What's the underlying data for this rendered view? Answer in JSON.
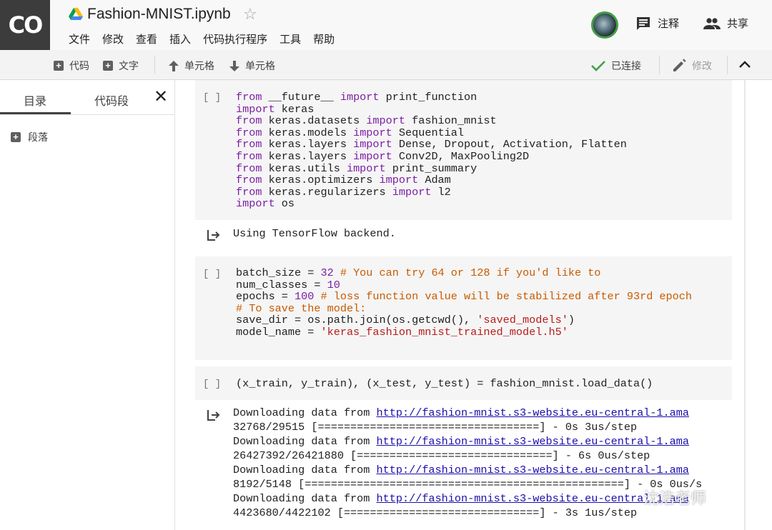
{
  "header": {
    "logo": "CO",
    "notebook_title": "Fashion-MNIST.ipynb",
    "menu": [
      "文件",
      "修改",
      "查看",
      "插入",
      "代码执行程序",
      "工具",
      "帮助"
    ],
    "comment_label": "注释",
    "share_label": "共享"
  },
  "toolbar": {
    "add_code": "代码",
    "add_text": "文字",
    "cell_up": "单元格",
    "cell_down": "单元格",
    "connected": "已连接",
    "edit": "修改"
  },
  "sidebar": {
    "tabs": [
      "目录",
      "代码段"
    ],
    "items": [
      "段落"
    ]
  },
  "cells": [
    {
      "run_label": "[ ]",
      "lines": [
        "from __future__ import print_function",
        "import keras",
        "from keras.datasets import fashion_mnist",
        "from keras.models import Sequential",
        "from keras.layers import Dense, Dropout, Activation, Flatten",
        "from keras.layers import Conv2D, MaxPooling2D",
        "from keras.utils import print_summary",
        "from keras.optimizers import Adam",
        "from keras.regularizers import l2",
        "import os"
      ],
      "output": [
        "Using TensorFlow backend."
      ]
    },
    {
      "run_label": "[ ]",
      "lines": [
        "batch_size = 32 # You can try 64 or 128 if you'd like to",
        "num_classes = 10",
        "epochs = 100 # loss function value will be stabilized after 93rd epoch",
        "# To save the model:",
        "save_dir = os.path.join(os.getcwd(), 'saved_models')",
        "model_name = 'keras_fashion_mnist_trained_model.h5'"
      ]
    },
    {
      "run_label": "[ ]",
      "lines": [
        "(x_train, y_train), (x_test, y_test) = fashion_mnist.load_data()"
      ],
      "output": [
        {
          "text": "Downloading data from ",
          "link": "http://fashion-mnist.s3-website.eu-central-1.ama"
        },
        {
          "text": "32768/29515 [==================================] - 0s 3us/step"
        },
        {
          "text": "Downloading data from ",
          "link": "http://fashion-mnist.s3-website.eu-central-1.ama"
        },
        {
          "text": "26427392/26421880 [==============================] - 6s 0us/step"
        },
        {
          "text": "Downloading data from ",
          "link": "http://fashion-mnist.s3-website.eu-central-1.ama"
        },
        {
          "text": "8192/5148 [=================================================] - 0s 0us/s"
        },
        {
          "text": "Downloading data from ",
          "link": "http://fashion-mnist.s3-website.eu-central-1.ama"
        },
        {
          "text": "4423680/4422102 [==============================] - 3s 1us/step"
        }
      ]
    }
  ],
  "watermark": "沈浩老师",
  "colors": {
    "keyword": "#7b1fa2",
    "comment": "#c85a00",
    "string": "#b71c1c",
    "link": "#1a0dab",
    "connected_check": "#43a047"
  }
}
